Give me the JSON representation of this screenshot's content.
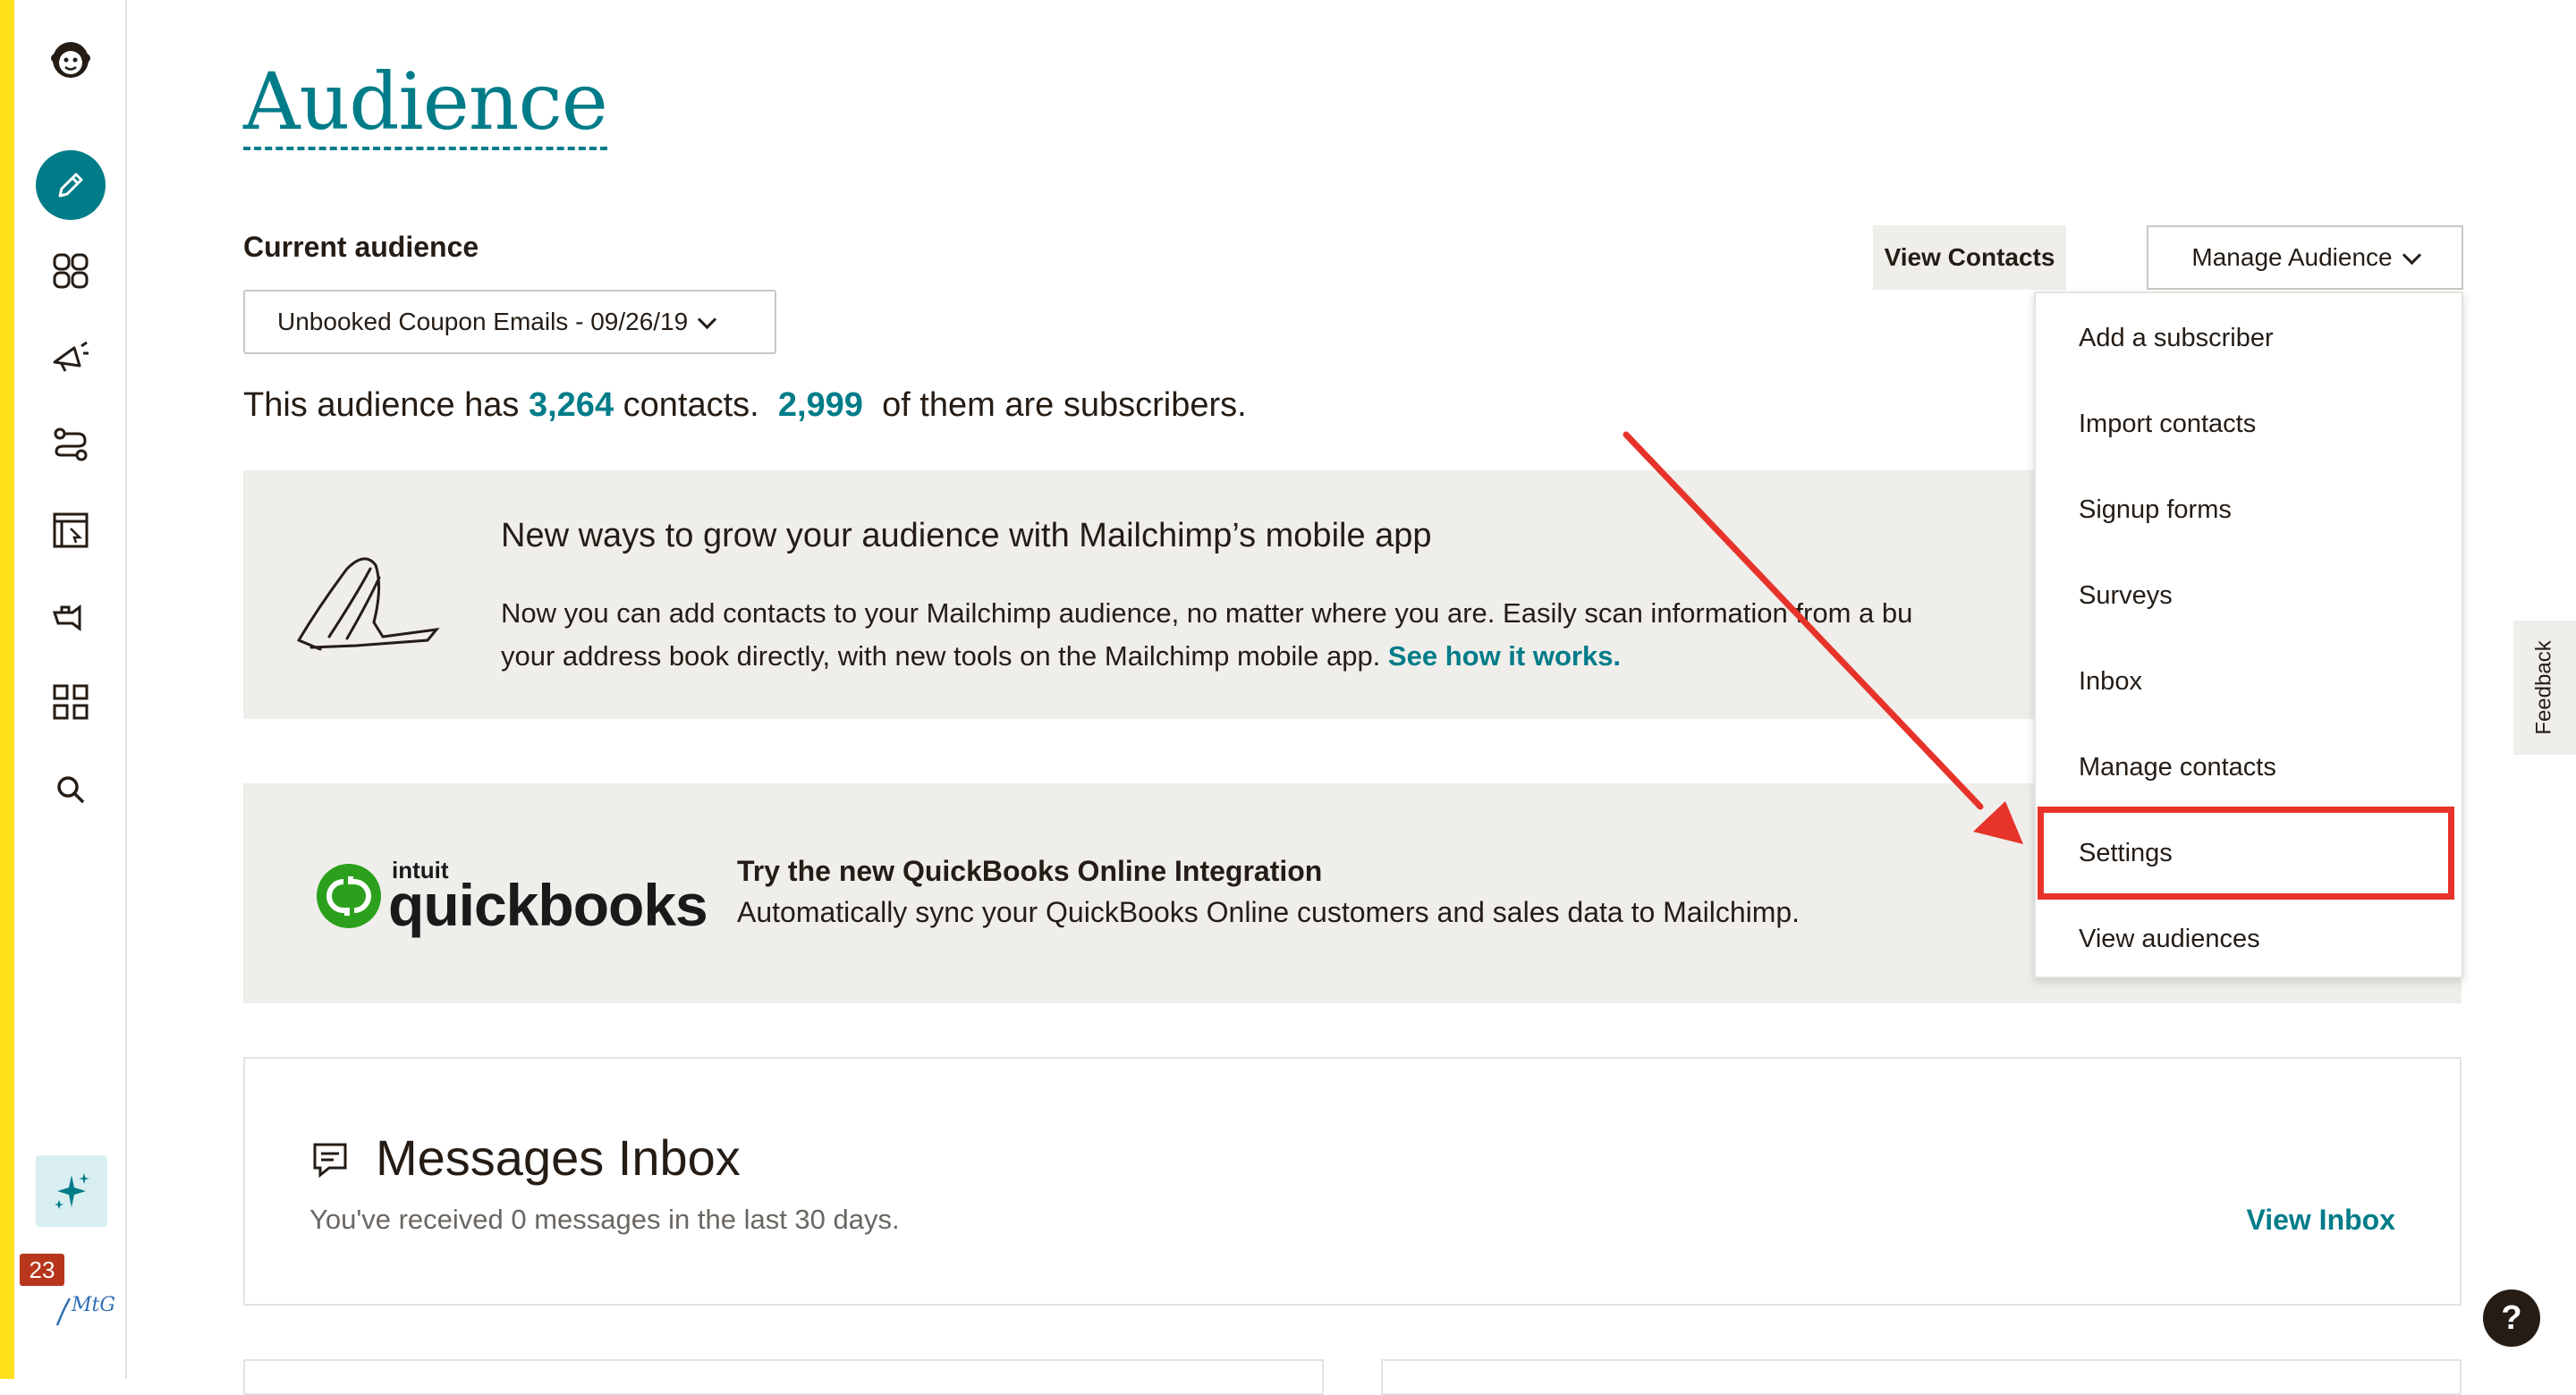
{
  "page": {
    "title": "Audience"
  },
  "audience": {
    "current_label": "Current audience",
    "selected": "Unbooked Coupon Emails - 09/26/19",
    "summary_prefix": "This audience has",
    "contacts_count": "3,264",
    "summary_mid": "contacts.",
    "subscribers_count": "2,999",
    "summary_suffix": "of them are subscribers."
  },
  "toolbar": {
    "view_contacts": "View Contacts",
    "manage_audience": "Manage Audience"
  },
  "manage_menu": {
    "items": [
      "Add a subscriber",
      "Import contacts",
      "Signup forms",
      "Surveys",
      "Inbox",
      "Manage contacts",
      "Settings",
      "View audiences"
    ],
    "highlighted": "Settings"
  },
  "mobile_promo": {
    "heading": "New ways to grow your audience with Mailchimp’s mobile app",
    "text_visible_1": "Now you can add contacts to your Mailchimp audience, no matter where you are. Easily scan infor",
    "text_visible_2": "mation from a bu",
    "text_line2": "your address book directly, with new tools on the Mailchimp mobile app.",
    "link": "See how it works."
  },
  "quickbooks_promo": {
    "logo_brand": "intuit",
    "logo_word": "quickbooks",
    "title": "Try the new QuickBooks Online Integration",
    "text": "Automatically sync your QuickBooks Online customers and sales data to Mailchimp."
  },
  "inbox": {
    "title": "Messages Inbox",
    "subtitle": "You've received 0 messages in the last 30 days.",
    "link": "View Inbox"
  },
  "sidebar": {
    "notification_count": "23",
    "account_logo": "MtG",
    "icons": [
      "mailchimp-logo-icon",
      "pencil-icon",
      "audience-icon",
      "megaphone-icon",
      "automations-icon",
      "website-icon",
      "integrations-icon",
      "grid-icon",
      "search-icon",
      "sparkle-icon"
    ]
  },
  "feedback": {
    "label": "Feedback"
  },
  "help": {
    "label": "?"
  },
  "colors": {
    "brand_teal": "#007c89",
    "yellow": "#ffe01b",
    "annotation_red": "#e7332a",
    "panel_gray": "#efeeea"
  }
}
